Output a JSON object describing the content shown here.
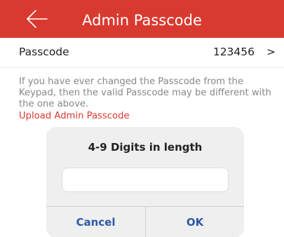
{
  "header": {
    "title": "Admin Passcode",
    "back_icon": "arrow-left-icon",
    "background_color": "#d93a30"
  },
  "passcode_row": {
    "label": "Passcode",
    "value": "123456",
    "chevron": ">"
  },
  "note": {
    "text": "If you have ever changed the Passcode from the Keypad, then the valid Passcode may be different with the one above.",
    "link_label": "Upload Admin Passcode",
    "link_color": "#d93a30"
  },
  "dialog": {
    "title": "4-9 Digits in length",
    "input_value": "",
    "cancel_label": "Cancel",
    "ok_label": "OK",
    "button_color": "#2b5aa5"
  }
}
